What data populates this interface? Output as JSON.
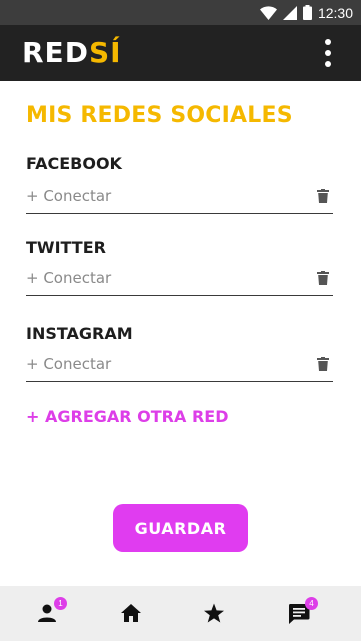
{
  "status_bar": {
    "time": "12:30",
    "icons": [
      "wifi-icon",
      "signal-icon",
      "battery-icon"
    ]
  },
  "app_bar": {
    "logo_part1": "RED",
    "logo_part2": "SÍ",
    "menu_icon": "more-vert-icon"
  },
  "page": {
    "title": "MIS REDES SOCIALES"
  },
  "networks": [
    {
      "label": "FACEBOOK",
      "placeholder": "+ Conectar",
      "value": ""
    },
    {
      "label": "TWITTER",
      "placeholder": "+ Conectar",
      "value": ""
    },
    {
      "label": "INSTAGRAM",
      "placeholder": "+ Conectar",
      "value": ""
    }
  ],
  "actions": {
    "add_network": "+ AGREGAR OTRA RED",
    "save": "GUARDAR"
  },
  "bottom_nav": {
    "items": [
      {
        "icon": "person-icon",
        "badge": "1"
      },
      {
        "icon": "home-icon",
        "badge": ""
      },
      {
        "icon": "star-icon",
        "badge": ""
      },
      {
        "icon": "chat-icon",
        "badge": "4"
      }
    ]
  },
  "colors": {
    "accent_yellow": "#f5b800",
    "accent_magenta": "#e03cf0",
    "app_bar": "#222222",
    "status_bar": "#3d3d3d"
  }
}
